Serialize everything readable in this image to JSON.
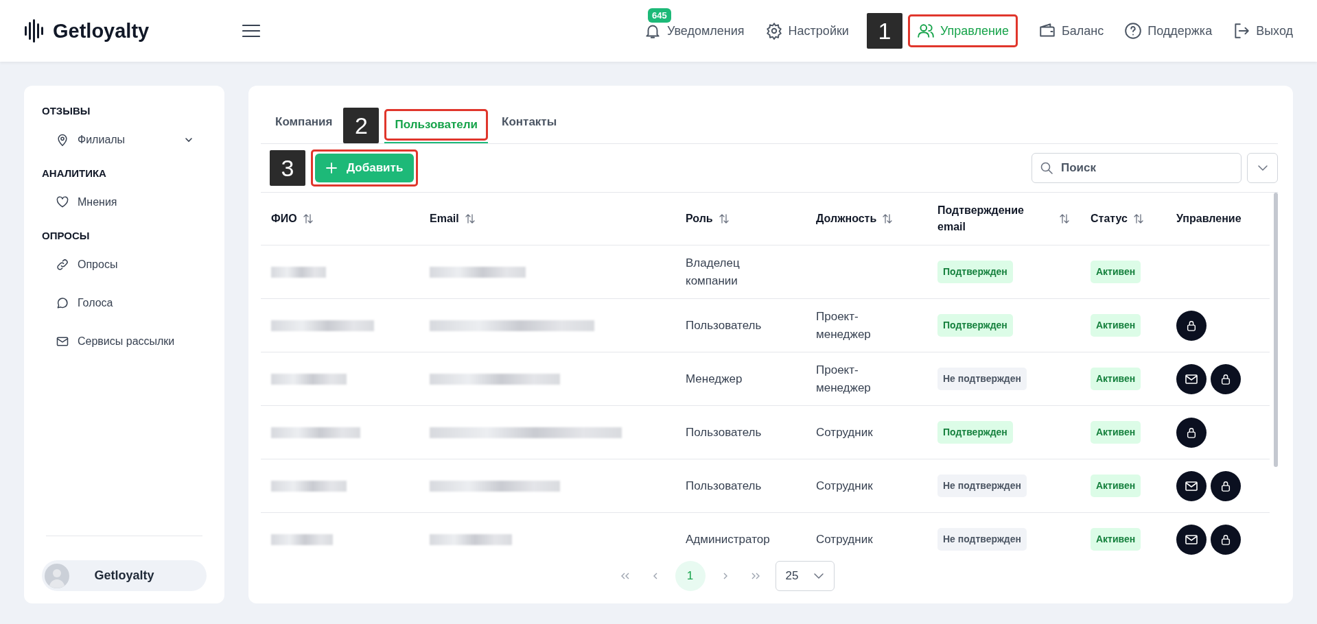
{
  "header": {
    "logo": "Getloyalty",
    "nav": [
      {
        "kind": "bell",
        "label": "Уведомления",
        "badge": "645",
        "selected": false
      },
      {
        "kind": "gear",
        "label": "Настройки",
        "selected": false
      },
      {
        "kind": "users",
        "label": "Управление",
        "selected": true,
        "annotation": "1"
      },
      {
        "kind": "wallet",
        "label": "Баланс",
        "selected": false
      },
      {
        "kind": "help",
        "label": "Поддержка",
        "selected": false
      },
      {
        "kind": "logout",
        "label": "Выход",
        "selected": false
      }
    ]
  },
  "sidebar": {
    "sections": [
      {
        "title": "ОТЗЫВЫ",
        "items": [
          {
            "kind": "pin",
            "label": "Филиалы",
            "expandable": true
          }
        ]
      },
      {
        "title": "АНАЛИТИКА",
        "items": [
          {
            "kind": "heart",
            "label": "Мнения",
            "expandable": false
          }
        ]
      },
      {
        "title": "ОПРОСЫ",
        "items": [
          {
            "kind": "link",
            "label": "Опросы",
            "expandable": false
          },
          {
            "kind": "chat",
            "label": "Голоса",
            "expandable": false
          },
          {
            "kind": "mail",
            "label": "Сервисы рассылки",
            "expandable": false
          }
        ]
      }
    ],
    "user": {
      "name": "Getloyalty"
    }
  },
  "tabs": [
    {
      "label": "Компания",
      "selected": false
    },
    {
      "label": "Пользователи",
      "selected": true,
      "annotation": "2"
    },
    {
      "label": "Контакты",
      "selected": false
    }
  ],
  "add_button": {
    "label": "Добавить",
    "annotation": "3"
  },
  "search": {
    "placeholder": "Поиск"
  },
  "table": {
    "columns": [
      {
        "label": "ФИО",
        "sortable": true
      },
      {
        "label": "Email",
        "sortable": true
      },
      {
        "label": "Роль",
        "sortable": true
      },
      {
        "label": "Должность",
        "sortable": true
      },
      {
        "label": "Подтверждение email",
        "sortable": true
      },
      {
        "label": "Статус",
        "sortable": true
      },
      {
        "label": "Управление",
        "sortable": false
      }
    ],
    "rows": [
      {
        "role": "Владелец компании",
        "email_status": {
          "text": "Подтвержден",
          "confirmed": true
        },
        "status": "Активен"
      },
      {
        "role": "Пользователь",
        "position": "Проект-менеджер",
        "email_status": {
          "text": "Подтвержден",
          "confirmed": true
        },
        "status": "Активен",
        "actions": [
          {
            "kind": "lock"
          }
        ]
      },
      {
        "role": "Менеджер",
        "position": "Проект-менеджер",
        "email_status": {
          "text": "Не подтвержден",
          "confirmed": false
        },
        "status": "Активен",
        "actions": [
          {
            "kind": "mail"
          },
          {
            "kind": "lock"
          }
        ]
      },
      {
        "role": "Пользователь",
        "position": "Сотрудник",
        "email_status": {
          "text": "Подтвержден",
          "confirmed": true
        },
        "status": "Активен",
        "actions": [
          {
            "kind": "lock"
          }
        ]
      },
      {
        "role": "Пользователь",
        "position": "Сотрудник",
        "email_status": {
          "text": "Не подтвержден",
          "confirmed": false
        },
        "status": "Активен",
        "actions": [
          {
            "kind": "mail"
          },
          {
            "kind": "lock"
          }
        ]
      },
      {
        "role": "Администратор",
        "position": "Сотрудник",
        "email_status": {
          "text": "Не подтвержден",
          "confirmed": false
        },
        "status": "Активен",
        "actions": [
          {
            "kind": "mail"
          },
          {
            "kind": "lock"
          }
        ]
      }
    ]
  },
  "pagination": {
    "pages": [
      {
        "label": "1",
        "selected": true
      }
    ],
    "page_size": "25"
  }
}
